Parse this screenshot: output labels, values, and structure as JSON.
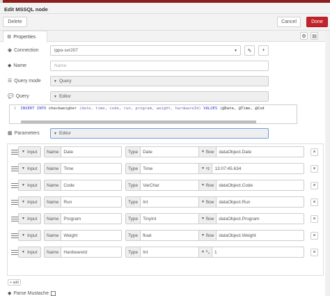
{
  "window": {
    "title": "Edit MSSQL node"
  },
  "toolbar": {
    "delete_label": "Delete",
    "cancel_label": "Cancel",
    "done_label": "Done"
  },
  "tabs": {
    "properties_label": "Properties"
  },
  "form": {
    "connection": {
      "label": "Connection",
      "value": "ippo-svr207"
    },
    "name": {
      "label": "Name",
      "placeholder": "Name"
    },
    "query_mode": {
      "label": "Query mode",
      "value": "Query"
    },
    "query": {
      "label": "Query",
      "value": "Editor"
    },
    "parameters": {
      "label": "Parameters",
      "value": "Editor"
    },
    "parse_mustache": {
      "label": "Parse Mustache"
    }
  },
  "editor": {
    "line_number": "1",
    "code": {
      "kw1": "INSERT INTO",
      "table": "checkweigher",
      "columns": "(date, time, code, run, program, weight, hardwareId)",
      "kw2": "VALUES",
      "values": "(@Date, @Time, @Cod"
    }
  },
  "param_labels": {
    "direction_prefix": "",
    "name_prefix": "Name",
    "type_prefix": "Type"
  },
  "params": [
    {
      "direction": "Input",
      "name": "Date",
      "type": "Date",
      "value_type": "flow",
      "value": "dataObject.Date"
    },
    {
      "direction": "Input",
      "name": "Time",
      "type": "Time",
      "value_type": "a_z",
      "value": "13:07:45.634"
    },
    {
      "direction": "Input",
      "name": "Code",
      "type": "VarChar",
      "value_type": "flow",
      "value": "dataObject.Code"
    },
    {
      "direction": "Input",
      "name": "Run",
      "type": "Int",
      "value_type": "flow",
      "value": "dataObject.Run"
    },
    {
      "direction": "Input",
      "name": "Program",
      "type": "TinyInt",
      "value_type": "flow",
      "value": "dataObject.Program"
    },
    {
      "direction": "Input",
      "name": "Weight",
      "type": "float",
      "value_type": "flow",
      "value": "dataObject.Weight"
    },
    {
      "direction": "Input",
      "name": "HardwareId",
      "type": "Int",
      "value_type": "num",
      "value": "1"
    }
  ],
  "params_value_type_labels": {
    "flow": "flow",
    "a_z": "ᵃz",
    "num": "⁰₉"
  },
  "add_label": "+ add",
  "colors": {
    "accent_red": "#c3242b",
    "header_bar": "#8c1e1e"
  }
}
